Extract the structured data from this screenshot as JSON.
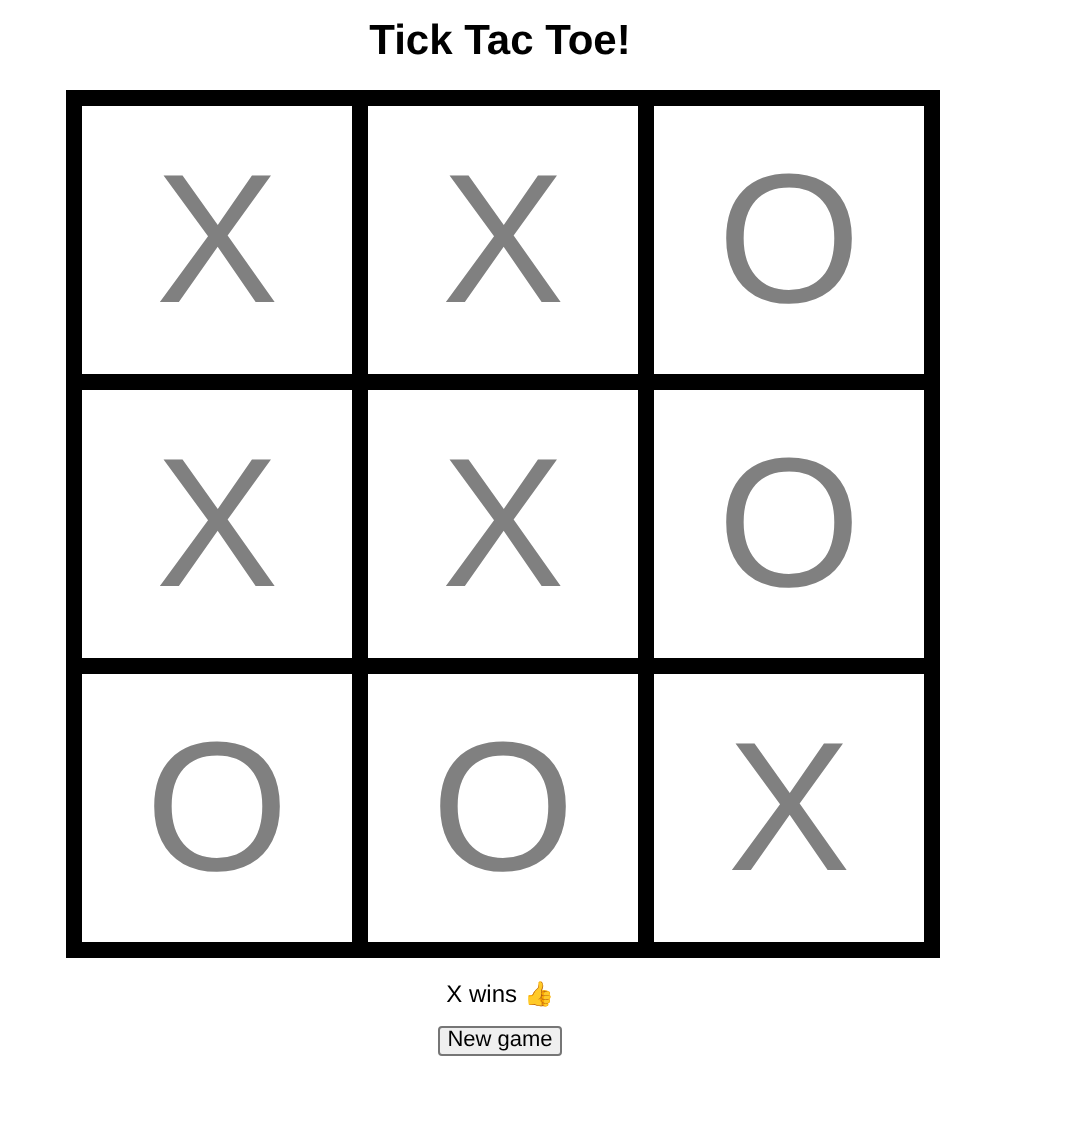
{
  "title": "Tick Tac Toe!",
  "board": [
    {
      "mark": "X"
    },
    {
      "mark": "X"
    },
    {
      "mark": "O"
    },
    {
      "mark": "X"
    },
    {
      "mark": "X"
    },
    {
      "mark": "O"
    },
    {
      "mark": "O"
    },
    {
      "mark": "O"
    },
    {
      "mark": "X"
    }
  ],
  "status": "X wins 👍",
  "button": "New game"
}
